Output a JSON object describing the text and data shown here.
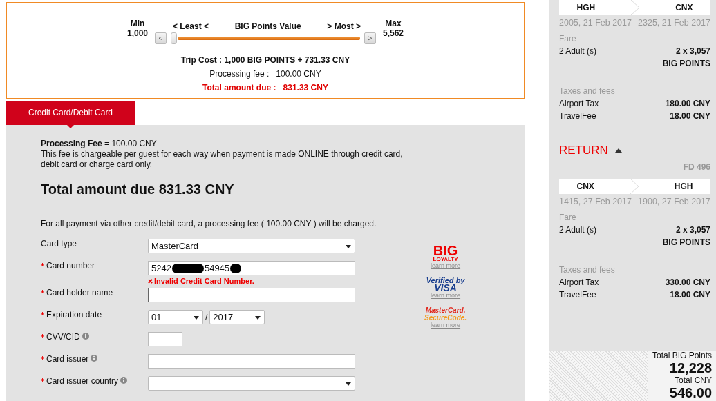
{
  "points_slider": {
    "min_label": "Min",
    "min_value": "1,000",
    "max_label": "Max",
    "max_value": "5,562",
    "least": "< Least <",
    "title": "BIG Points Value",
    "most": "> Most >",
    "left_button": "<",
    "right_button": ">",
    "level": 0
  },
  "summary": {
    "trip_cost": "Trip Cost : 1,000 BIG POINTS + 731.33 CNY",
    "fee_label": "Processing fee :",
    "fee_value": "100.00 CNY",
    "total_label": "Total amount due :",
    "total_value": "831.33 CNY"
  },
  "tabs": [
    {
      "label": "Credit Card/Debit Card",
      "selected": true
    }
  ],
  "payment": {
    "fee_note": "**Processing Fee** = 100.00 CNY",
    "fee_text": "This fee is chargeable per guest for each way when payment is made ONLINE through credit card, debit card or charge card only.",
    "total_heading": "Total amount due 831.33 CNY",
    "other_note": "For all payment via other credit/debit card, a processing fee ( 100.00 CNY ) will be charged.",
    "fields": [
      {
        "label": "Card type",
        "required": false,
        "info": false,
        "kind": "select",
        "value": "MasterCard"
      },
      {
        "label": "Card number",
        "required": true,
        "info": false,
        "kind": "masked",
        "parts": [
          "5242",
          "54945"
        ],
        "error": "Invalid Credit Card Number."
      },
      {
        "label": "Card holder name",
        "required": true,
        "info": false,
        "kind": "text",
        "focused": true
      },
      {
        "label": "Expiration date",
        "required": true,
        "info": false,
        "kind": "date",
        "month": "01",
        "separator": "/",
        "year": "2017"
      },
      {
        "label": "CVV/CID",
        "required": true,
        "info": true,
        "kind": "short"
      },
      {
        "label": "Card issuer",
        "required": true,
        "info": true,
        "kind": "text",
        "focused": false
      },
      {
        "label": "Card issuer country",
        "required": true,
        "info": true,
        "kind": "select"
      }
    ],
    "logos": [
      {
        "kind": "big",
        "lines": [
          "BIG",
          "LOYALTY"
        ],
        "link": "learn more"
      },
      {
        "kind": "visa",
        "lines": [
          "Verified by",
          "VISA"
        ],
        "link": "learn more"
      },
      {
        "kind": "mc",
        "lines": [
          "MasterCard.",
          "SecureCode."
        ],
        "link": "learn more"
      }
    ]
  },
  "sidebar": {
    "legs": [
      {
        "from": "HGH",
        "to": "CNX",
        "depart": "2005, 21 Feb 2017",
        "arrive": "2325, 21 Feb 2017",
        "fare_label": "Fare",
        "pax": "2 Adult (s)",
        "fare_amount": "2 x 3,057",
        "fare_unit": "BIG POINTS",
        "taxes_label": "Taxes and fees",
        "fees": [
          {
            "name": "Airport Tax",
            "amount": "180.00 CNY"
          },
          {
            "name": "TravelFee",
            "amount": "18.00 CNY"
          }
        ]
      },
      {
        "from": "CNX",
        "to": "HGH",
        "depart": "1415, 27 Feb 2017",
        "arrive": "1900, 27 Feb 2017",
        "fare_label": "Fare",
        "pax": "2 Adult (s)",
        "fare_amount": "2 x 3,057",
        "fare_unit": "BIG POINTS",
        "taxes_label": "Taxes and fees",
        "fees": [
          {
            "name": "Airport Tax",
            "amount": "330.00 CNY"
          },
          {
            "name": "TravelFee",
            "amount": "18.00 CNY"
          }
        ]
      }
    ],
    "return_heading": "RETURN",
    "return_expanded": true,
    "return_flight": "FD 496",
    "totals": {
      "points_label": "Total BIG Points",
      "points": "12,228",
      "cny_label": "Total CNY",
      "cny": "546.00"
    }
  }
}
